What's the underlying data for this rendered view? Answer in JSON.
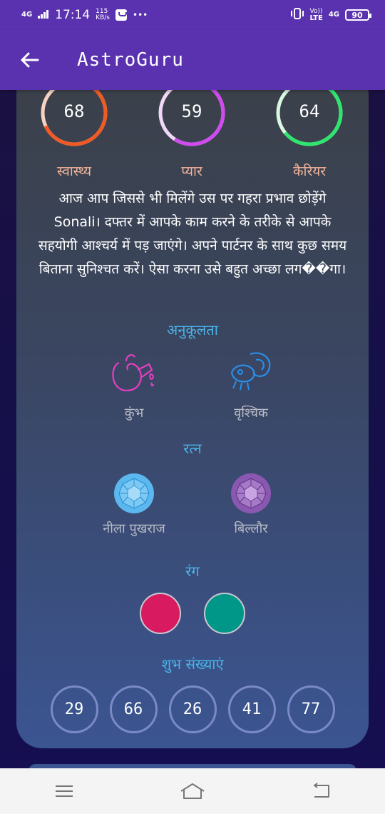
{
  "status_bar": {
    "network": "4G",
    "time": "17:14",
    "speed_top": "115",
    "speed_bottom": "KB/s",
    "dots": "•••",
    "volte": "Vo))",
    "lte": "LTE",
    "network_right": "4G",
    "battery": "90"
  },
  "app_bar": {
    "title": "AstroGuru",
    "back_icon": "arrow-left-icon"
  },
  "scores": [
    {
      "value": "68",
      "label": "स्वास्थ्य",
      "color": "#f15a24",
      "track": "#f6d2c2",
      "percent": 68
    },
    {
      "value": "59",
      "label": "प्यार",
      "color": "#d04bef",
      "track": "#f2d8f8",
      "percent": 59
    },
    {
      "value": "64",
      "label": "कैरियर",
      "color": "#2ee66e",
      "track": "#d8f8e2",
      "percent": 64
    }
  ],
  "description": "आज आप जिससे भी मिलेंगे उस पर गहरा प्रभाव छोड़ेंगे Sonali। दफ्तर में आपके काम करने के तरीके से आपके सहयोगी आश्चर्य में पड़ जाएंगे। अपने पार्टनर के साथ कुछ समय बिताना सुनिश्चत करें। ऐसा करना उसे बहुत अच्छा लग��गा।",
  "compatibility": {
    "title": "अनुकूलता",
    "items": [
      {
        "label": "कुंभ",
        "icon": "aquarius-icon",
        "color": "#e83ec1"
      },
      {
        "label": "वृश्चिक",
        "icon": "scorpio-icon",
        "color": "#2a8ee8"
      }
    ]
  },
  "gems": {
    "title": "रत्न",
    "items": [
      {
        "label": "नीला पुखराज",
        "icon": "blue-topaz-icon",
        "color": "#5ab8ee"
      },
      {
        "label": "बिल्लौर",
        "icon": "amethyst-icon",
        "color": "#9060b8"
      }
    ]
  },
  "colors": {
    "title": "रंग",
    "items": [
      {
        "hex": "#d81b60"
      },
      {
        "hex": "#009688"
      }
    ]
  },
  "lucky_numbers": {
    "title": "शुभ संख्याएं",
    "items": [
      "29",
      "66",
      "26",
      "41",
      "77"
    ]
  },
  "nav": {
    "menu_icon": "menu-icon",
    "home_icon": "home-icon",
    "back_icon": "back-icon"
  }
}
